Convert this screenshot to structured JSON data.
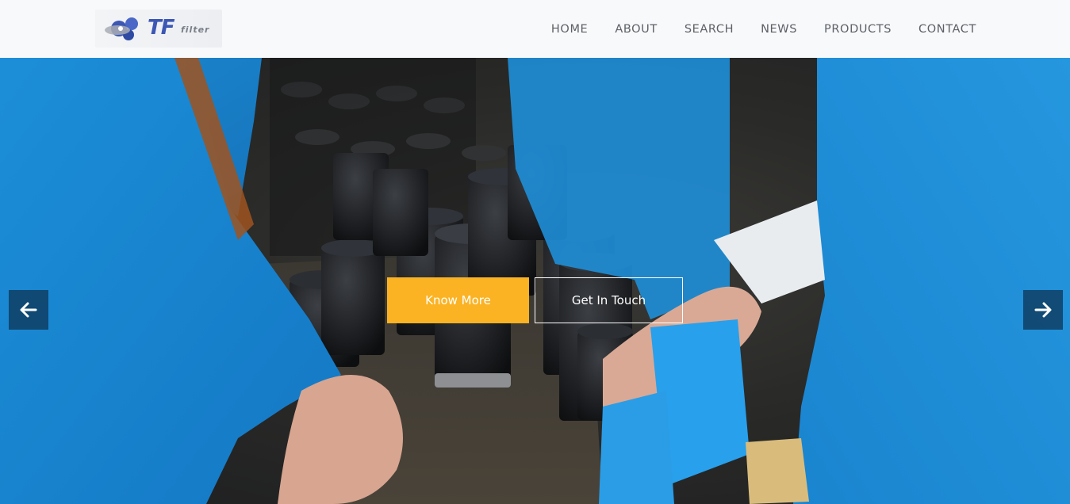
{
  "brand": {
    "logo_text": "TF",
    "logo_sub": "filter",
    "colors": {
      "primary": "#3c57b4",
      "accent": "#fbb324",
      "nav_text": "#5d6066"
    }
  },
  "nav": {
    "items": [
      {
        "label": "HOME"
      },
      {
        "label": "ABOUT"
      },
      {
        "label": "SEARCH"
      },
      {
        "label": "NEWS"
      },
      {
        "label": "PRODUCTS"
      },
      {
        "label": "CONTACT"
      }
    ]
  },
  "hero": {
    "primary_button": "Know More",
    "secondary_button": "Get In Touch",
    "prev_icon": "arrow-left-icon",
    "next_icon": "arrow-right-icon"
  }
}
